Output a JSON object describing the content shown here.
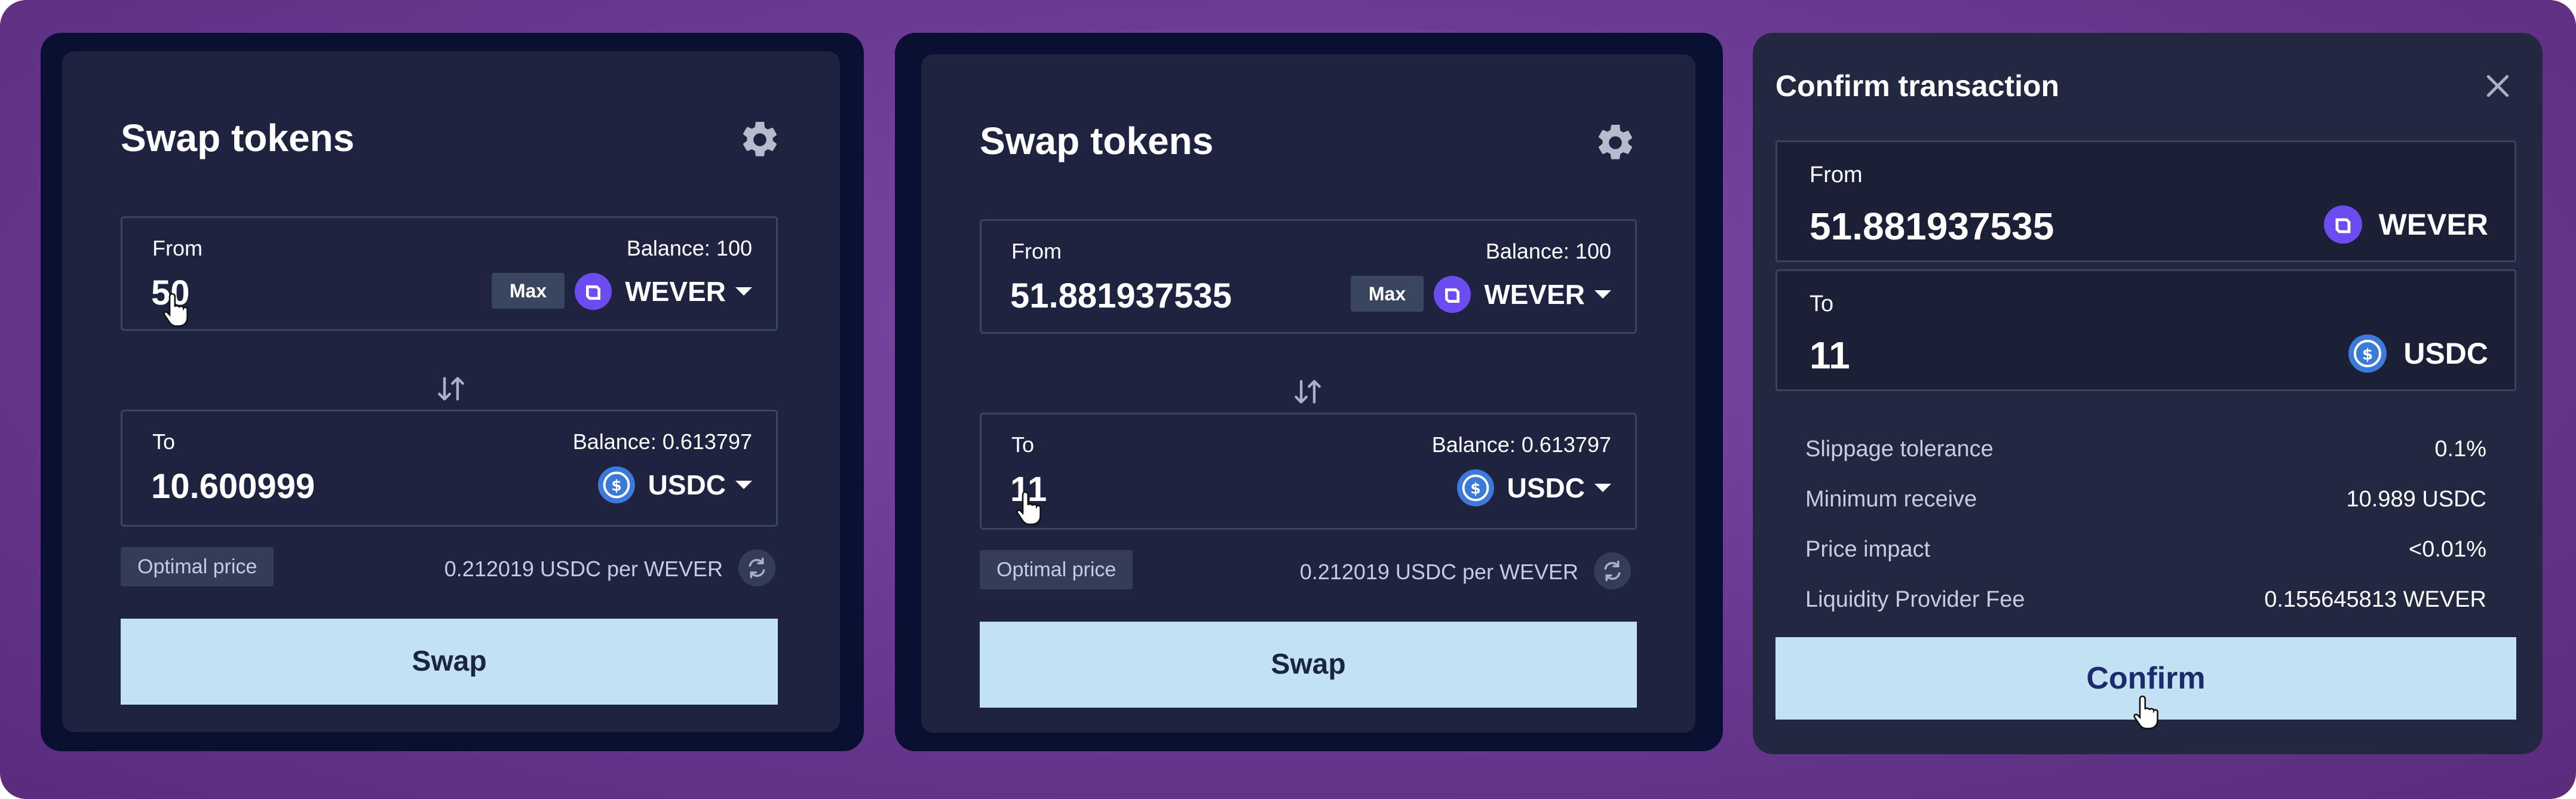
{
  "colors": {
    "background": "#6c3b95",
    "panel_dark": "#0a1032",
    "panel_inner": "#1e2340",
    "confirm_panel": "#22283f",
    "button_bg": "#c2e1f3",
    "button_text": "#1b2440",
    "wever_icon": "#6c4cf0",
    "usdc_icon": "#3b7ad9"
  },
  "panels": [
    {
      "title": "Swap tokens",
      "settings_icon": "gear-icon",
      "from": {
        "label": "From",
        "balance": "Balance: 100",
        "value": "50",
        "max_label": "Max",
        "token": "WEVER"
      },
      "switch_icon": "swap-direction-icon",
      "to": {
        "label": "To",
        "balance": "Balance: 0.613797",
        "value": "10.600999",
        "token": "USDC"
      },
      "optimal_label": "Optimal price",
      "rate": "0.212019 USDC per WEVER",
      "swap_label": "Swap"
    },
    {
      "title": "Swap tokens",
      "settings_icon": "gear-icon",
      "from": {
        "label": "From",
        "balance": "Balance: 100",
        "value": "51.881937535",
        "max_label": "Max",
        "token": "WEVER"
      },
      "switch_icon": "swap-direction-icon",
      "to": {
        "label": "To",
        "balance": "Balance: 0.613797",
        "value": "11",
        "token": "USDC"
      },
      "optimal_label": "Optimal price",
      "rate": "0.212019 USDC per WEVER",
      "swap_label": "Swap"
    }
  ],
  "confirm": {
    "title": "Confirm transaction",
    "close_icon": "close-icon",
    "from": {
      "label": "From",
      "value": "51.881937535",
      "token": "WEVER"
    },
    "to": {
      "label": "To",
      "value": "11",
      "token": "USDC"
    },
    "details": [
      {
        "key": "Slippage tolerance",
        "value": "0.1%"
      },
      {
        "key": "Minimum receive",
        "value": "10.989 USDC"
      },
      {
        "key": "Price impact",
        "value": "<0.01%"
      },
      {
        "key": "Liquidity Provider Fee",
        "value": "0.155645813 WEVER"
      }
    ],
    "confirm_label": "Confirm"
  }
}
